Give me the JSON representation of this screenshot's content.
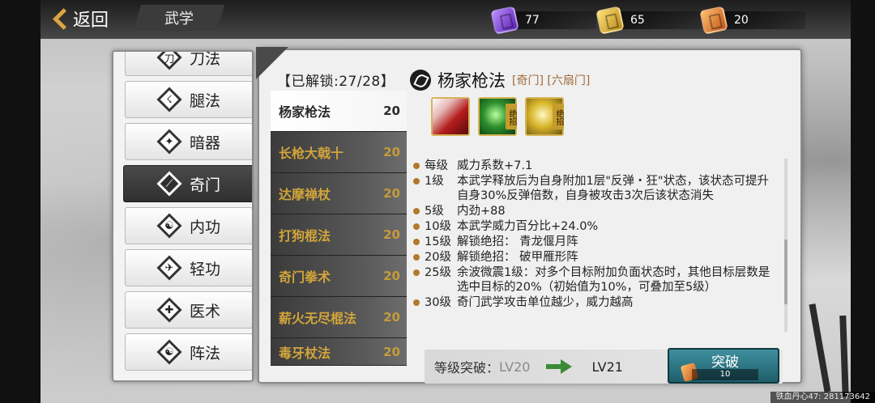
{
  "header": {
    "back_label": "返回",
    "page_title": "武学"
  },
  "currencies": [
    {
      "icon": "purple-scroll-icon",
      "value": "77",
      "color": "#7a3cc7"
    },
    {
      "icon": "gold-scroll-icon",
      "value": "65",
      "color": "#d3a21f"
    },
    {
      "icon": "orange-scroll-icon",
      "value": "20",
      "color": "#d8742a"
    }
  ],
  "categories": [
    {
      "label": "刀法",
      "icon": "blade-icon"
    },
    {
      "label": "腿法",
      "icon": "kick-icon"
    },
    {
      "label": "暗器",
      "icon": "shuriken-icon"
    },
    {
      "label": "奇门",
      "icon": "weapon-icon",
      "active": true
    },
    {
      "label": "内功",
      "icon": "meditation-icon"
    },
    {
      "label": "轻功",
      "icon": "agility-icon"
    },
    {
      "label": "医术",
      "icon": "medicine-icon"
    },
    {
      "label": "阵法",
      "icon": "taiji-icon"
    }
  ],
  "skill_list": {
    "unlock_label": "【已解锁:27/28】",
    "items": [
      {
        "name": "杨家枪法",
        "level": "20",
        "selected": true
      },
      {
        "name": "长枪大戟十",
        "level": "20"
      },
      {
        "name": "达摩禅杖",
        "level": "20"
      },
      {
        "name": "打狗棍法",
        "level": "20"
      },
      {
        "name": "奇门拳术",
        "level": "20"
      },
      {
        "name": "薪火无尽棍法",
        "level": "20"
      },
      {
        "name": "毒牙杖法",
        "level": "20"
      }
    ]
  },
  "detail": {
    "name": "杨家枪法",
    "tags": "[奇门] [六扇门]",
    "moves": [
      {
        "icon": "spear-strike-icon",
        "badge": ""
      },
      {
        "icon": "green-vortex-icon",
        "badge": "绝招"
      },
      {
        "icon": "golden-burst-icon",
        "badge": "绝招"
      }
    ],
    "effects": [
      {
        "lv": "每级",
        "text": "威力系数+7.1"
      },
      {
        "lv": "1级",
        "text": "本武学释放后为自身附加1层\"反弹・狂\"状态，该状态可提升自身30%反弹倍数，自身被攻击3次后该状态消失"
      },
      {
        "lv": "5级",
        "text": "内劲+88"
      },
      {
        "lv": "10级",
        "text": "本武学威力百分比+24.0%"
      },
      {
        "lv": "15级",
        "text": "解锁绝招： 青龙偃月阵"
      },
      {
        "lv": "20级",
        "text": "解锁绝招： 破甲雁形阵"
      },
      {
        "lv": "25级",
        "text": "余波微震1级：对多个目标附加负面状态时，其他目标层数是选中目标的20%（初始值为10%，可叠加至5级）"
      },
      {
        "lv": "30级",
        "text": "奇门武学攻击单位越少，威力越高"
      }
    ],
    "breakthrough": {
      "label": "等级突破：",
      "from": "LV20",
      "to": "LV21",
      "button_label": "突破",
      "cost": "10"
    }
  },
  "watermark": "铁血丹心47: 281173642"
}
